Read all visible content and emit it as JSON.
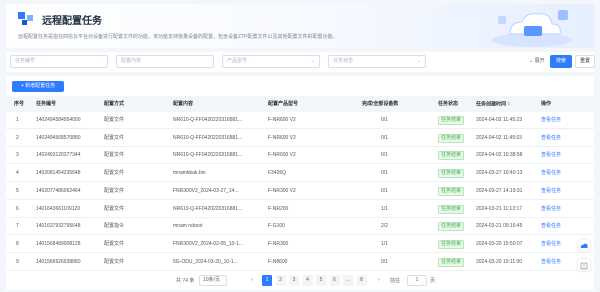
{
  "header": {
    "title": "远程配置任务",
    "description": "远程配置任务是指在四信云平台对设备进行配置文件的功能，该功能支持批量设备的配置，包含设备ZTP配置文件以及其他配置文件的配置功能。"
  },
  "filters": {
    "task_id_placeholder": "任务编号",
    "config_content_placeholder": "配置内容",
    "product_model_placeholder": "产品型号",
    "task_status_placeholder": "任务状态",
    "expand_label": "展开",
    "search_label": "搜索",
    "reset_label": "重置"
  },
  "toolbar": {
    "new_task_label": "+ 新增配置任务"
  },
  "table": {
    "columns": [
      "序号",
      "任务编号",
      "配置方式",
      "配置内容",
      "配置产品型号",
      "完成/全部设备数",
      "任务状态",
      "任务创建时间",
      "操作"
    ],
    "rows": [
      {
        "no": "1",
        "task_id": "1402494584954000",
        "method": "配置文件",
        "content": "NR610-Q-FF0420220316881...",
        "model": "F-NR600 V2",
        "progress": "0/1",
        "status": "任务结束",
        "created": "2024-04-02 11:45:23",
        "action": "查看任务"
      },
      {
        "no": "2",
        "task_id": "1402494568570880",
        "method": "配置文件",
        "content": "NR610-Q-FF0420220316881...",
        "model": "F-NR600 V2",
        "progress": "0/1",
        "status": "任务结束",
        "created": "2024-04-02 11:45:03",
        "action": "查看任务"
      },
      {
        "no": "3",
        "task_id": "1402493120377344",
        "method": "配置文件",
        "content": "NR610-Q-FF0420220316881...",
        "model": "F-NR600 V2",
        "progress": "0/1",
        "status": "任务结束",
        "created": "2024-04-02 10:38:58",
        "action": "查看任务"
      },
      {
        "no": "4",
        "task_id": "1402081454235648",
        "method": "配置文件",
        "content": "mnamkbak.bin",
        "model": "F3426Q",
        "progress": "0/1",
        "status": "任务结束",
        "created": "2024-03-27 10:40:13",
        "action": "查看任务"
      },
      {
        "no": "5",
        "task_id": "1402077486062464",
        "method": "配置文件",
        "content": "FNR300V2_2024-03-27_14...",
        "model": "F-NR300 V2",
        "progress": "0/1",
        "status": "任务结束",
        "created": "2024-03-27 14:19:31",
        "action": "查看任务"
      },
      {
        "no": "6",
        "task_id": "1401643661109120",
        "method": "配置文件",
        "content": "NR610-Q-FF0420220316881...",
        "model": "F-NR200",
        "progress": "1/1",
        "status": "任务结束",
        "created": "2024-03-21 11:13:17",
        "action": "查看任务"
      },
      {
        "no": "7",
        "task_id": "1401637932795648",
        "method": "配置指令",
        "content": "mnam reboot",
        "model": "F-G100",
        "progress": "2/2",
        "status": "任务结束",
        "created": "2024-03-21 09:16:45",
        "action": "查看任务"
      },
      {
        "no": "8",
        "task_id": "1401568489008128",
        "method": "配置文件",
        "content": "FNR300V2_2024-02-05_10-1...",
        "model": "F-NR300",
        "progress": "1/1",
        "status": "任务结束",
        "created": "2024-03-20 15:50:07",
        "action": "查看任务"
      },
      {
        "no": "9",
        "task_id": "1401566926938880",
        "method": "配置文件",
        "content": "5G-ODU_2024-03-20_10-1...",
        "model": "F-N8600",
        "progress": "0/1",
        "status": "任务结束",
        "created": "2024-03-20 10:11:00",
        "action": "查看任务"
      }
    ]
  },
  "pagination": {
    "total_label": "共 74 条",
    "page_size": "10条/页",
    "pages": [
      "1",
      "2",
      "3",
      "4",
      "5",
      "6",
      "...",
      "8"
    ],
    "current_page": "1",
    "goto_label": "前往",
    "goto_value": "1",
    "page_suffix": "页"
  },
  "colors": {
    "primary": "#2f7bff",
    "status_success": "#3bb345"
  },
  "icons": [
    "logo-icon",
    "chevron-down-icon",
    "sort-icon",
    "prev-icon",
    "next-icon",
    "cloud-icon",
    "feedback-icon"
  ]
}
